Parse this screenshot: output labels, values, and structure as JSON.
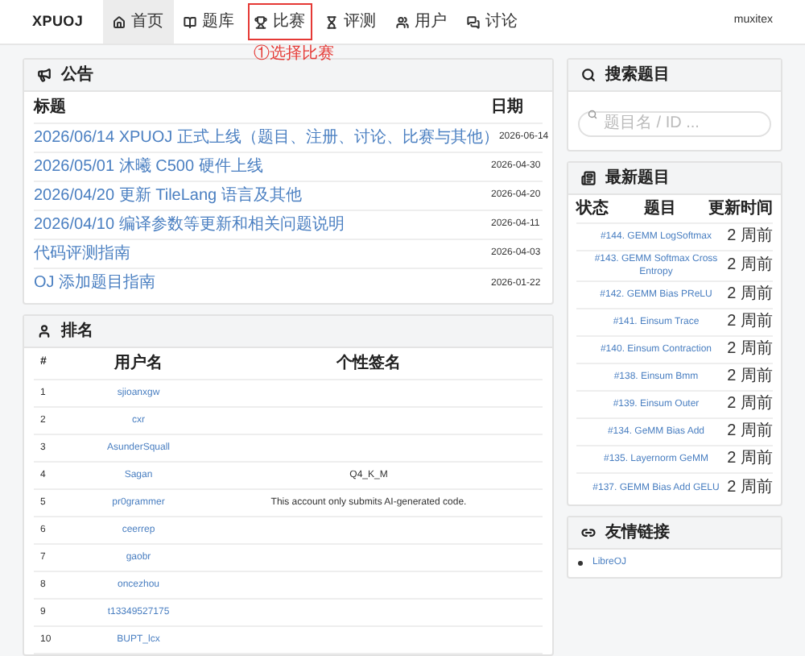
{
  "navbar": {
    "brand": "XPUOJ",
    "items": [
      {
        "label": "首页",
        "selected": true,
        "highlighted": false
      },
      {
        "label": "题库",
        "selected": false,
        "highlighted": false
      },
      {
        "label": "比赛",
        "selected": false,
        "highlighted": true
      },
      {
        "label": "评测",
        "selected": false,
        "highlighted": false
      },
      {
        "label": "用户",
        "selected": false,
        "highlighted": false
      },
      {
        "label": "讨论",
        "selected": false,
        "highlighted": false
      }
    ],
    "user": "muxitex",
    "annotation": "①选择比赛"
  },
  "announcements": {
    "title": "公告",
    "columns": [
      "标题",
      "日期"
    ],
    "rows": [
      {
        "title": "2026/06/14 XPUOJ 正式上线（题目、注册、讨论、比赛与其他）",
        "date": "2026-06-14"
      },
      {
        "title": "2026/05/01 沐曦 C500 硬件上线",
        "date": "2026-04-30"
      },
      {
        "title": "2026/04/20 更新 TileLang 语言及其他",
        "date": "2026-04-20"
      },
      {
        "title": "2026/04/10 编译参数等更新和相关问题说明",
        "date": "2026-04-11"
      },
      {
        "title": "代码评测指南",
        "date": "2026-04-03"
      },
      {
        "title": "OJ 添加题目指南",
        "date": "2026-01-22"
      }
    ]
  },
  "ranking": {
    "title": "排名",
    "columns": [
      "#",
      "用户名",
      "个性签名"
    ],
    "rows": [
      {
        "rank": "1",
        "user": "sjioanxgw"
      },
      {
        "rank": "2",
        "user": "cxr"
      },
      {
        "rank": "3",
        "user": "AsunderSquall"
      },
      {
        "rank": "4",
        "user": "Sagan",
        "motto": "Q4_K_M"
      },
      {
        "rank": "5",
        "user": "pr0grammer",
        "motto": "This account only submits AI-generated code."
      },
      {
        "rank": "6",
        "user": "ceerrep"
      },
      {
        "rank": "7",
        "user": "gaobr"
      },
      {
        "rank": "8",
        "user": "oncezhou"
      },
      {
        "rank": "9",
        "user": "t13349527175"
      },
      {
        "rank": "10",
        "user": "BUPT_lcx"
      }
    ]
  },
  "search": {
    "title": "搜索题目",
    "placeholder": "题目名 / ID ..."
  },
  "latest": {
    "title": "最新题目",
    "columns": [
      "状态",
      "题目",
      "更新时间"
    ],
    "rows": [
      {
        "title": "#144. GEMM LogSoftmax",
        "time": "2 周前"
      },
      {
        "title": "#143. GEMM Softmax Cross Entropy",
        "time": "2 周前"
      },
      {
        "title": "#142. GEMM Bias PReLU",
        "time": "2 周前"
      },
      {
        "title": "#141. Einsum Trace",
        "time": "2 周前"
      },
      {
        "title": "#140. Einsum Contraction",
        "time": "2 周前"
      },
      {
        "title": "#138. Einsum Bmm",
        "time": "2 周前"
      },
      {
        "title": "#139. Einsum Outer",
        "time": "2 周前"
      },
      {
        "title": "#134. GeMM Bias Add",
        "time": "2 周前"
      },
      {
        "title": "#135. Layernorm GeMM",
        "time": "2 周前"
      },
      {
        "title": "#137. GEMM Bias Add GELU",
        "time": "2 周前"
      }
    ]
  },
  "links": {
    "title": "友情链接",
    "items": [
      "LibreOJ"
    ]
  }
}
